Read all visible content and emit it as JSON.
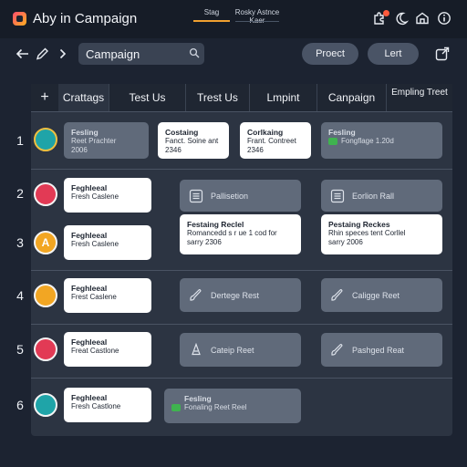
{
  "window": {
    "title": "Aby in Campaign",
    "center_tab_a": "Stag",
    "center_tab_b": "Rosky Astnce Kaer"
  },
  "toolbar": {
    "search_value": "Campaign",
    "project_label": "Proect",
    "left_label": "Lert"
  },
  "board": {
    "tabs": [
      "Crattags",
      "Test Us",
      "Trest Us",
      "Lmpint",
      "Canpaign",
      "Empling Treet"
    ],
    "rows": [
      {
        "num": "1",
        "icon_color": "#1fa4a8",
        "icon_letter": "",
        "icon_ring": "#f0c040",
        "cards": [
          {
            "style": "grey",
            "title": "Fesling",
            "sub": "Reet Prachter",
            "sub2": "2006"
          },
          {
            "style": "white",
            "title": "Costaing",
            "sub": "Fanct. Soine ant",
            "sub2": "2346"
          },
          {
            "style": "white",
            "title": "Corlkaing",
            "sub": "Frant. Contreet",
            "sub2": "2346"
          },
          {
            "style": "grey",
            "title": "Fesling",
            "sub": "Fongflage 1.20d",
            "sub2": ""
          }
        ]
      },
      {
        "num": "2",
        "icon_color": "#e23a55",
        "icon_letter": "",
        "card": {
          "title": "Feghleeal",
          "sub": "Fresh Caslene"
        },
        "actions": [
          {
            "label": "Pallisetion"
          },
          {
            "label": "Eorlion Rall"
          }
        ]
      },
      {
        "num": "3",
        "icon_color": "#f2a623",
        "icon_letter": "A",
        "card": {
          "title": "Feghleeal",
          "sub": "Fresh Caslene"
        },
        "wide": [
          {
            "title": "Festaing Reclel",
            "sub": "Romancedd s r ue 1 cod for",
            "sub2": "sarry 2306"
          },
          {
            "title": "Pestaing Reckes",
            "sub": "Rhin speces tent Corllel",
            "sub2": "sarry 2006"
          }
        ]
      },
      {
        "num": "4",
        "icon_color": "#f2a623",
        "icon_letter": "",
        "card": {
          "title": "Feghleeal",
          "sub": "Frest Caslene"
        },
        "actions": [
          {
            "label": "Dertege Rest"
          },
          {
            "label": "Caligge Reet"
          }
        ]
      },
      {
        "num": "5",
        "icon_color": "#e23a55",
        "icon_letter": "",
        "card": {
          "title": "Feghleeal",
          "sub": "Freat Castlone"
        },
        "actions": [
          {
            "label": "Cateip Reet"
          },
          {
            "label": "Pashged Reat"
          }
        ]
      },
      {
        "num": "6",
        "icon_color": "#1fa4a8",
        "icon_letter": "",
        "card": {
          "title": "Feghleeal",
          "sub": "Fresh Castlone"
        },
        "green": {
          "title": "Fesling",
          "sub": "Fonaling Reet Reel"
        }
      }
    ]
  },
  "colors": {
    "background": "#1c2331",
    "board": "#2c3442",
    "accent_orange": "#f0a030",
    "notification": "#ff5a3c"
  },
  "icons": [
    "app-logo",
    "puzzle-icon",
    "moon-icon",
    "home-icon",
    "info-icon",
    "back-arrow-icon",
    "edit-icon",
    "forward-arrow-icon",
    "search-icon",
    "export-icon",
    "plus-icon",
    "list-icon",
    "brush-icon",
    "pen-icon",
    "bottle-icon"
  ]
}
